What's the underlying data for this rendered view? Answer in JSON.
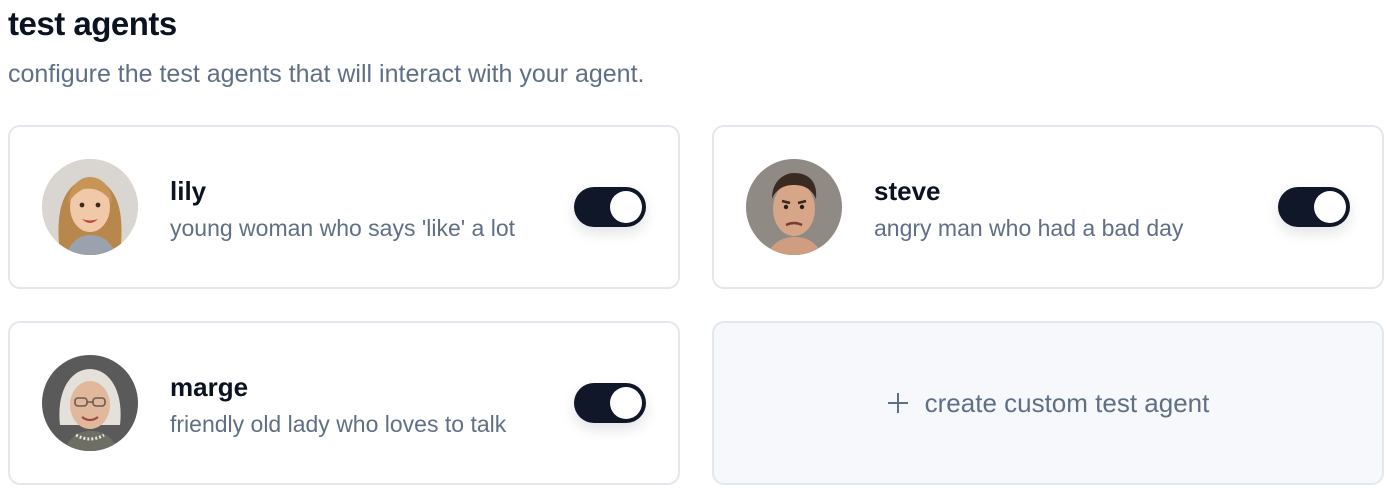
{
  "header": {
    "title": "test agents",
    "subtitle": "configure the test agents that will interact with your agent."
  },
  "agents": [
    {
      "name": "lily",
      "description": "young woman who says 'like' a lot",
      "enabled": true
    },
    {
      "name": "steve",
      "description": "angry man who had a bad day",
      "enabled": true
    },
    {
      "name": "marge",
      "description": "friendly old lady who loves to talk",
      "enabled": true
    }
  ],
  "create": {
    "icon": "plus-icon",
    "label": "create custom test agent"
  },
  "colors": {
    "title": "#0b1220",
    "muted_text": "#5f6f86",
    "toggle_on": "#0f1729",
    "card_border": "#e3e7ee",
    "create_card_bg": "#f6f8fb"
  }
}
